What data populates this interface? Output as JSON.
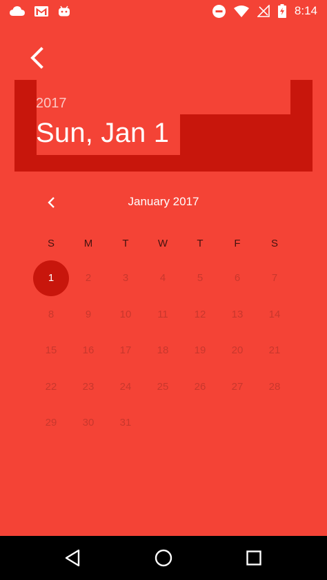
{
  "status_bar": {
    "time": "8:14",
    "left_icons": [
      "cloud-icon",
      "gmail-icon",
      "android-icon"
    ],
    "right_icons": [
      "do-not-disturb-icon",
      "wifi-icon",
      "no-sim-icon",
      "battery-charging-icon"
    ]
  },
  "header": {
    "back_icon": "back-arrow-icon",
    "year": "2017",
    "selected_date": "Sun, Jan 1"
  },
  "calendar": {
    "month_title": "January 2017",
    "prev_icon": "chevron-left-icon",
    "weekdays": [
      "S",
      "M",
      "T",
      "W",
      "T",
      "F",
      "S"
    ],
    "selected_day": "1",
    "weeks": [
      [
        "1",
        "2",
        "3",
        "4",
        "5",
        "6",
        "7"
      ],
      [
        "8",
        "9",
        "10",
        "11",
        "12",
        "13",
        "14"
      ],
      [
        "15",
        "16",
        "17",
        "18",
        "19",
        "20",
        "21"
      ],
      [
        "22",
        "23",
        "24",
        "25",
        "26",
        "27",
        "28"
      ],
      [
        "29",
        "30",
        "31"
      ]
    ]
  },
  "nav_bar": {
    "icons": [
      "back-triangle-icon",
      "home-circle-icon",
      "recents-square-icon"
    ]
  },
  "colors": {
    "accent": "#f44336",
    "accent_dark": "#c8160c",
    "nav_bar": "#000000"
  }
}
